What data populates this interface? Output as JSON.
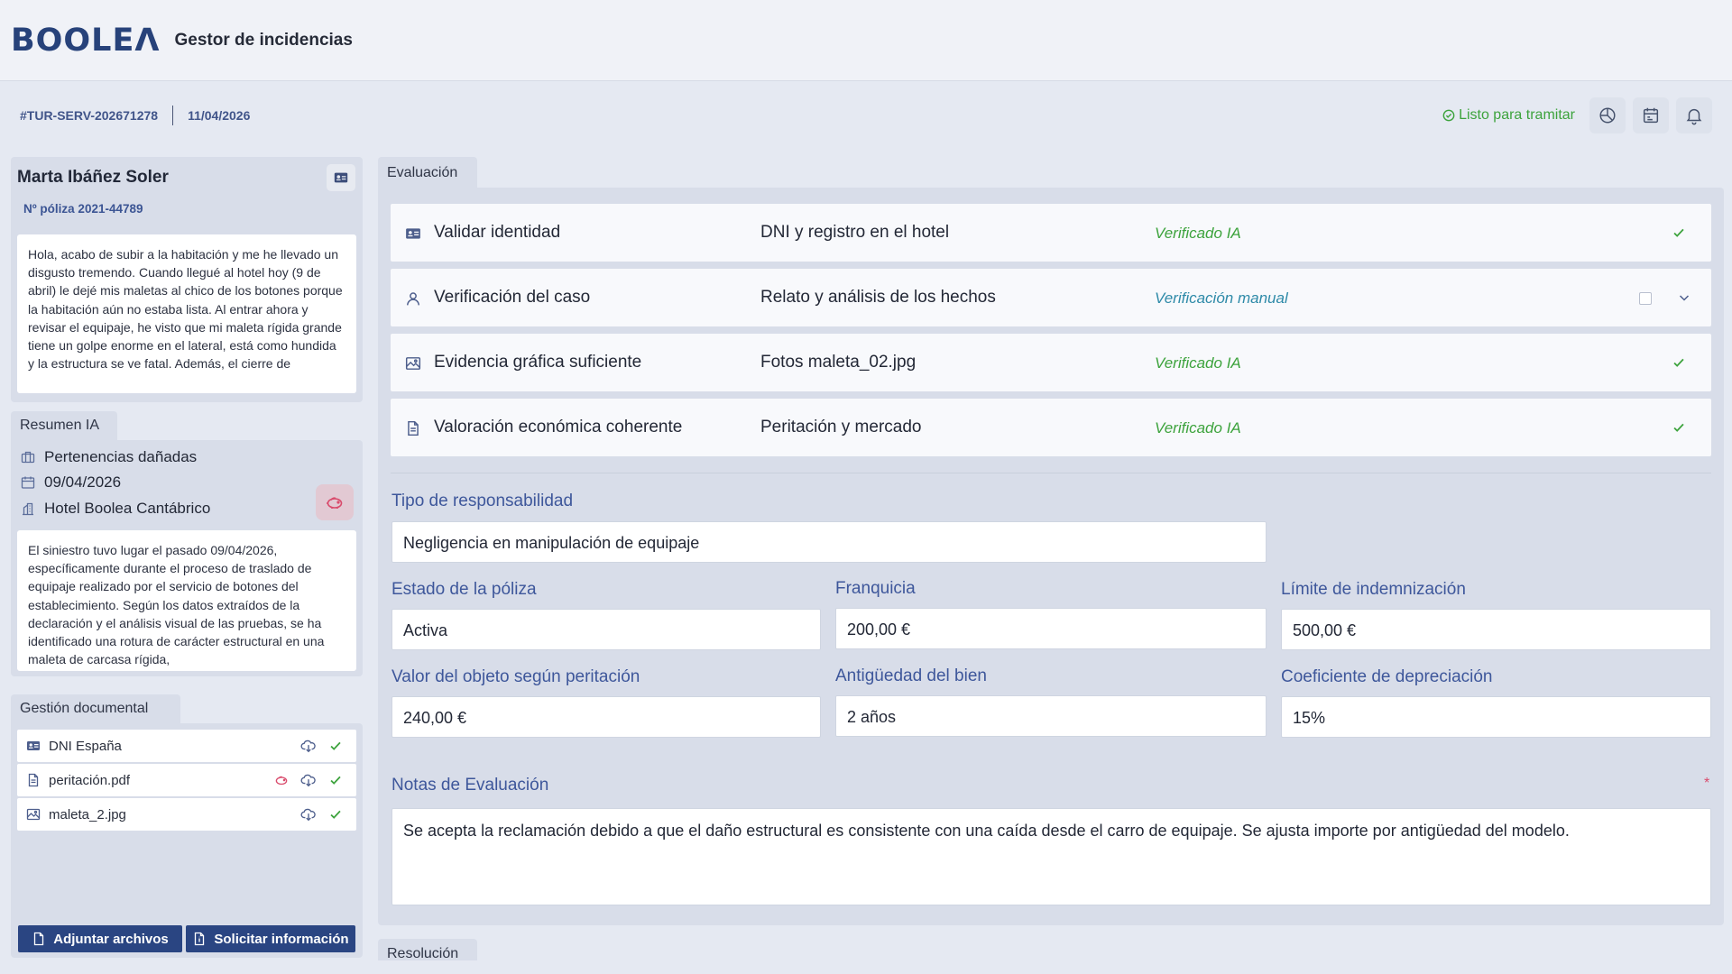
{
  "brand": {
    "logo": "BOOLEΛ",
    "app_title": "Gestor de incidencias"
  },
  "case": {
    "id": "#TUR-SERV-202671278",
    "date": "11/04/2026",
    "status": "Listo para tramitar"
  },
  "client": {
    "name": "Marta Ibáñez Soler",
    "policy": "Nº póliza 2021-44789",
    "message": "Hola, acabo de subir a la habitación y me he llevado un disgusto tremendo. Cuando llegué al hotel hoy (9 de abril) le dejé mis maletas al chico de los botones porque la habitación aún no estaba lista. Al entrar ahora y revisar el equipaje, he visto que mi maleta rígida grande tiene un golpe enorme en el lateral, está como hundida y la estructura se ve fatal. Además, el cierre de"
  },
  "summary": {
    "tab": "Resumen IA",
    "category": "Pertenencias dañadas",
    "date": "09/04/2026",
    "location": "Hotel Boolea Cantábrico",
    "text": "El siniestro tuvo lugar el pasado 09/04/2026, específicamente durante el proceso de traslado de equipaje realizado por el servicio de botones del establecimiento. Según los datos extraídos de la declaración y el análisis visual de las pruebas, se ha identificado una rotura de carácter estructural en una maleta de carcasa rígida,"
  },
  "documents": {
    "tab": "Gestión documental",
    "items": [
      {
        "name": "DNI España"
      },
      {
        "name": "peritación.pdf"
      },
      {
        "name": "maleta_2.jpg"
      }
    ],
    "attach_label": "Adjuntar archivos",
    "request_label": "Solicitar información"
  },
  "evaluation": {
    "tab": "Evaluación",
    "checks": [
      {
        "name": "Validar identidad",
        "source": "DNI y registro en el hotel",
        "status": "Verificado IA"
      },
      {
        "name": "Verificación del caso",
        "source": "Relato y análisis de los hechos",
        "status": "Verificación manual"
      },
      {
        "name": "Evidencia gráfica suficiente",
        "source": "Fotos maleta_02.jpg",
        "status": "Verificado IA"
      },
      {
        "name": "Valoración económica coherente",
        "source": "Peritación y mercado",
        "status": "Verificado IA"
      }
    ],
    "fields": {
      "responsabilidad_label": "Tipo de responsabilidad",
      "responsabilidad": "Negligencia en manipulación de equipaje",
      "estado_label": "Estado de la póliza",
      "estado": "Activa",
      "franquicia_label": "Franquicia",
      "franquicia": "200,00 €",
      "limite_label": "Límite de indemnización",
      "limite": "500,00 €",
      "valor_label": "Valor del objeto según peritación",
      "valor": "240,00 €",
      "antiguedad_label": "Antigüedad del bien",
      "antiguedad": "2 años",
      "coef_label": "Coeficiente de depreciación",
      "coef": "15%"
    },
    "notes_label": "Notas de Evaluación",
    "notes_required_mark": "*",
    "notes": "Se acepta la reclamación debido a que el daño estructural es consistente con una caída desde el carro de equipaje. Se ajusta importe por antigüedad del modelo."
  },
  "resolution": {
    "tab": "Resolución"
  },
  "colors": {
    "brand": "#27427a",
    "ok": "#3da33d",
    "manual": "#2e8aa8",
    "alert": "#d94b6c",
    "label": "#3e579b"
  }
}
